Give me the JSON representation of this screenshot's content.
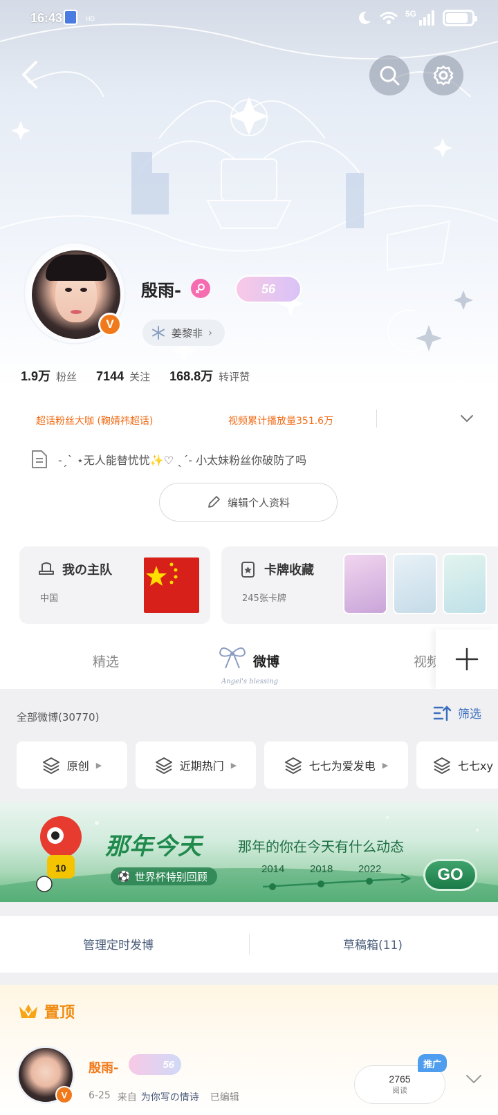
{
  "status_bar": {
    "time": "16:43",
    "network": "5G",
    "battery_level": 0.85
  },
  "profile": {
    "username": "殷雨-",
    "verified_badge": "V",
    "level": "56",
    "tag": "姜黎非",
    "stats": [
      {
        "value": "1.9万",
        "label": "粉丝"
      },
      {
        "value": "7144",
        "label": "关注"
      },
      {
        "value": "168.8万",
        "label": "转评赞"
      }
    ],
    "honors": [
      "超话粉丝大咖 (鞠婧祎超话)",
      "视频累计播放量351.6万"
    ],
    "bio": "-ˏˋ ⋆无人能替忧忧✨♡ ˎˊ- 小太妹粉丝你破防了吗",
    "edit_label": "编辑个人资料"
  },
  "cards": [
    {
      "title": "我の主队",
      "sub": "中国",
      "icon": "hat-icon"
    },
    {
      "title": "卡牌收藏",
      "sub": "245张卡牌",
      "icon": "card-star-icon"
    }
  ],
  "tabs": [
    {
      "label": "精选",
      "active": false
    },
    {
      "label": "微博",
      "active": true
    },
    {
      "label": "视频",
      "active": false
    }
  ],
  "tab_deco_text": "Angel's blessing",
  "feed": {
    "count_label": "全部微博(30770)",
    "filter_label": "筛选",
    "chips": [
      "原创",
      "近期热门",
      "七七为爱发电",
      "七七xy"
    ]
  },
  "promo": {
    "title": "那年今天",
    "subtitle": "那年的你在今天有什么动态",
    "pill": "世界杯特别回顾",
    "years": [
      "2014",
      "2018",
      "2022"
    ],
    "go": "GO"
  },
  "actions": [
    "管理定时发博",
    "草稿箱(11)"
  ],
  "pinned": {
    "label": "置顶",
    "name": "殷雨-",
    "level": "56",
    "date": "6-25",
    "from_prefix": "来自",
    "source": "为你写の情诗",
    "edited": "已编辑",
    "read_count": "2765",
    "read_label": "阅读",
    "promote": "推广"
  },
  "colors": {
    "accent_orange": "#f06b16",
    "link_blue": "#3a6fbf",
    "promo_green": "#1f8a4c"
  }
}
